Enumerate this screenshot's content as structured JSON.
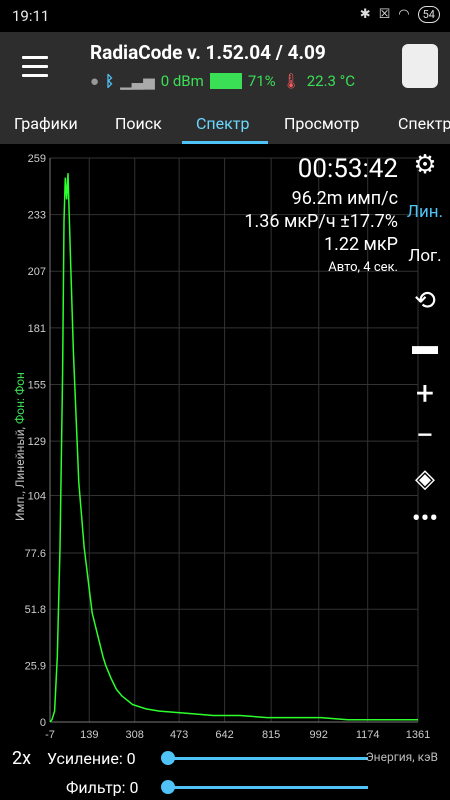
{
  "status": {
    "time": "19:11",
    "battery": "54"
  },
  "app": {
    "title": "RadiaCode v. 1.52.04 / 4.09",
    "signal": "0 dBm",
    "battery": "71%",
    "temp": "22.3 °C"
  },
  "tabs": [
    "Графики",
    "Поиск",
    "Спектр",
    "Просмотр",
    "Спектр"
  ],
  "readout": {
    "time": "00:53:42",
    "cps": "96.2m имп/с",
    "dose_rate": "1.36 мкР/ч ±17.7%",
    "dose": "1.22 мкР",
    "mode": "Авто, 4 сек."
  },
  "scale": {
    "lin": "Лин.",
    "log": "Лог."
  },
  "ylabel": {
    "main": "Имп., Линейный, ",
    "fon": "Фон: Фон"
  },
  "chart_data": {
    "type": "line",
    "xlabel": "Энергия, кэВ",
    "x_ticks": [
      "-7",
      "139",
      "308",
      "473",
      "642",
      "815",
      "992",
      "1174",
      "1361"
    ],
    "y_ticks": [
      "0",
      "25.9",
      "51.8",
      "77.6",
      "104",
      "129",
      "155",
      "181",
      "207",
      "233",
      "259"
    ],
    "ylim": [
      0,
      259
    ],
    "series": [
      {
        "color": "#2cff2c",
        "points": [
          [
            -7,
            0
          ],
          [
            0,
            1
          ],
          [
            10,
            5
          ],
          [
            20,
            30
          ],
          [
            30,
            80
          ],
          [
            40,
            160
          ],
          [
            45,
            230
          ],
          [
            50,
            250
          ],
          [
            55,
            240
          ],
          [
            60,
            252
          ],
          [
            65,
            230
          ],
          [
            70,
            210
          ],
          [
            80,
            170
          ],
          [
            90,
            140
          ],
          [
            100,
            110
          ],
          [
            110,
            95
          ],
          [
            120,
            80
          ],
          [
            130,
            70
          ],
          [
            140,
            60
          ],
          [
            150,
            50
          ],
          [
            160,
            45
          ],
          [
            170,
            40
          ],
          [
            180,
            35
          ],
          [
            190,
            30
          ],
          [
            200,
            26
          ],
          [
            220,
            20
          ],
          [
            240,
            15
          ],
          [
            260,
            12
          ],
          [
            280,
            10
          ],
          [
            300,
            8
          ],
          [
            350,
            6
          ],
          [
            400,
            5
          ],
          [
            500,
            4
          ],
          [
            600,
            3
          ],
          [
            700,
            3
          ],
          [
            800,
            2
          ],
          [
            900,
            2
          ],
          [
            1000,
            2
          ],
          [
            1100,
            1
          ],
          [
            1200,
            1
          ],
          [
            1361,
            1
          ]
        ]
      }
    ]
  },
  "bottom": {
    "zoom": "2x",
    "gain": "Усиление: 0",
    "filter": "Фильтр: 0",
    "energy": "Энергия, кэВ"
  }
}
